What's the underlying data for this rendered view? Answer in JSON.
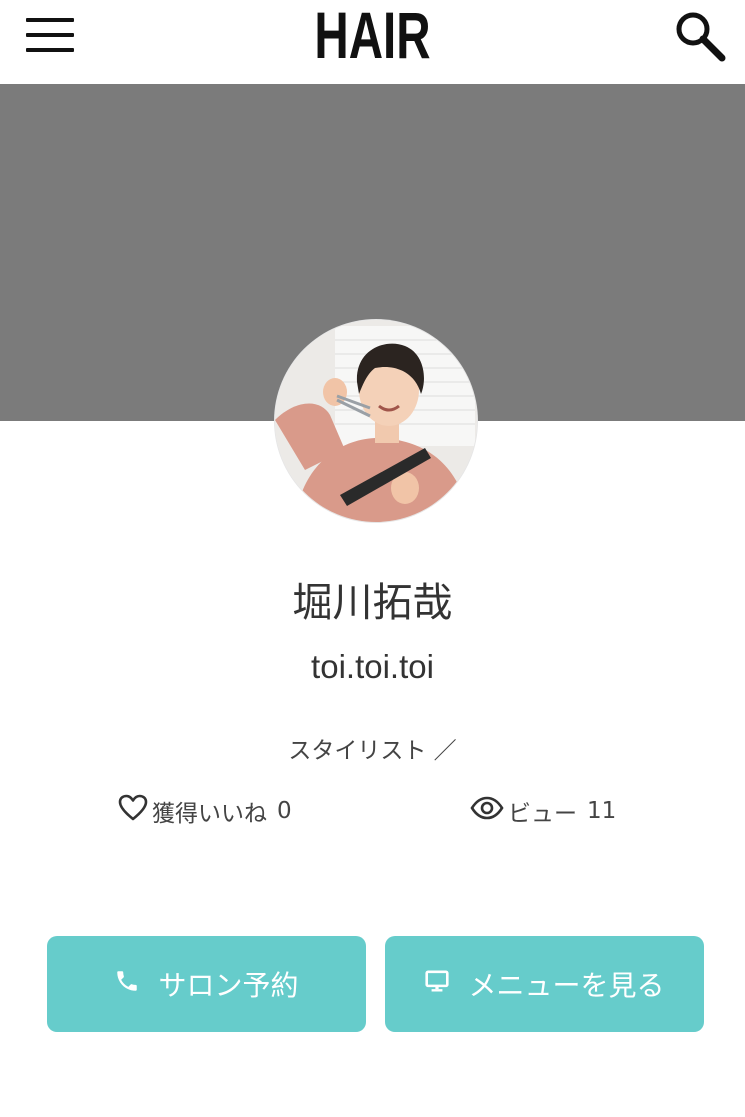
{
  "header": {
    "logo_text": "HAIR",
    "menu_icon": "hamburger-menu-icon",
    "search_icon": "search-icon"
  },
  "cover": {
    "color": "#7b7b7b"
  },
  "profile": {
    "avatar_alt": "stylist photo",
    "name": "堀川拓哉",
    "salon": "toi.toi.toi",
    "role": "スタイリスト ／"
  },
  "stats": {
    "likes_label": "獲得いいね",
    "likes_count": "0",
    "views_label": "ビュー",
    "views_count": "11"
  },
  "actions": {
    "salon_reserve_label": "サロン予約",
    "view_menu_label": "メニューを見る"
  },
  "colors": {
    "accent": "#66cccb",
    "text": "#333333"
  }
}
